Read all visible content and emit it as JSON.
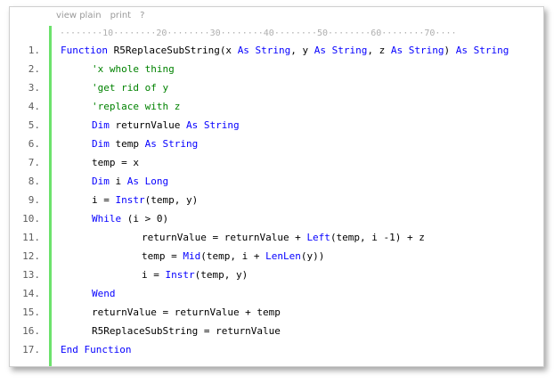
{
  "toolbar": {
    "view_plain": "view plain",
    "print": "print",
    "help": "?"
  },
  "ruler": "········10········20········30········40········50········60········70····",
  "colors": {
    "keyword": "#0600ff",
    "comment": "#008200",
    "gutter_accent": "#6ce26c",
    "line_number": "#5c5c5c"
  },
  "lines": [
    {
      "n": "1.",
      "indent": 0,
      "tokens": [
        [
          "kw",
          "Function"
        ],
        [
          "t",
          " R5ReplaceSubString(x "
        ],
        [
          "kw",
          "As String"
        ],
        [
          "t",
          ", y "
        ],
        [
          "kw",
          "As String"
        ],
        [
          "t",
          ", z "
        ],
        [
          "kw",
          "As String"
        ],
        [
          "t",
          ") "
        ],
        [
          "kw",
          "As String"
        ]
      ]
    },
    {
      "n": "2.",
      "indent": 1,
      "tokens": [
        [
          "cm",
          "'x whole thing"
        ]
      ]
    },
    {
      "n": "3.",
      "indent": 1,
      "tokens": [
        [
          "cm",
          "'get rid of y"
        ]
      ]
    },
    {
      "n": "4.",
      "indent": 1,
      "tokens": [
        [
          "cm",
          "'replace with z"
        ]
      ]
    },
    {
      "n": "5.",
      "indent": 1,
      "tokens": [
        [
          "kw",
          "Dim"
        ],
        [
          "t",
          " returnValue "
        ],
        [
          "kw",
          "As String"
        ]
      ]
    },
    {
      "n": "6.",
      "indent": 1,
      "tokens": [
        [
          "kw",
          "Dim"
        ],
        [
          "t",
          " temp "
        ],
        [
          "kw",
          "As String"
        ]
      ]
    },
    {
      "n": "7.",
      "indent": 1,
      "tokens": [
        [
          "t",
          "temp = x"
        ]
      ]
    },
    {
      "n": "8.",
      "indent": 1,
      "tokens": [
        [
          "kw",
          "Dim"
        ],
        [
          "t",
          " i "
        ],
        [
          "kw",
          "As Long"
        ]
      ]
    },
    {
      "n": "9.",
      "indent": 1,
      "tokens": [
        [
          "t",
          "i = "
        ],
        [
          "kw",
          "Instr"
        ],
        [
          "t",
          "(temp, y)"
        ]
      ]
    },
    {
      "n": "10.",
      "indent": 1,
      "tokens": [
        [
          "kw",
          "While"
        ],
        [
          "t",
          " (i > 0)"
        ]
      ]
    },
    {
      "n": "11.",
      "indent": 2,
      "tokens": [
        [
          "t",
          "returnValue = returnValue + "
        ],
        [
          "kw",
          "Left"
        ],
        [
          "t",
          "(temp, i -1) + z"
        ]
      ]
    },
    {
      "n": "12.",
      "indent": 2,
      "tokens": [
        [
          "t",
          "temp = "
        ],
        [
          "kw",
          "Mid"
        ],
        [
          "t",
          "(temp, i + "
        ],
        [
          "kw",
          "LenLen"
        ],
        [
          "t",
          "(y))"
        ]
      ]
    },
    {
      "n": "13.",
      "indent": 2,
      "tokens": [
        [
          "t",
          "i = "
        ],
        [
          "kw",
          "Instr"
        ],
        [
          "t",
          "(temp, y)"
        ]
      ]
    },
    {
      "n": "14.",
      "indent": 1,
      "tokens": [
        [
          "kw",
          "Wend"
        ]
      ]
    },
    {
      "n": "15.",
      "indent": 1,
      "tokens": [
        [
          "t",
          "returnValue = returnValue + temp"
        ]
      ]
    },
    {
      "n": "16.",
      "indent": 1,
      "tokens": [
        [
          "t",
          "R5ReplaceSubString = returnValue"
        ]
      ]
    },
    {
      "n": "17.",
      "indent": 0,
      "tokens": [
        [
          "kw",
          "End Function"
        ]
      ]
    }
  ]
}
